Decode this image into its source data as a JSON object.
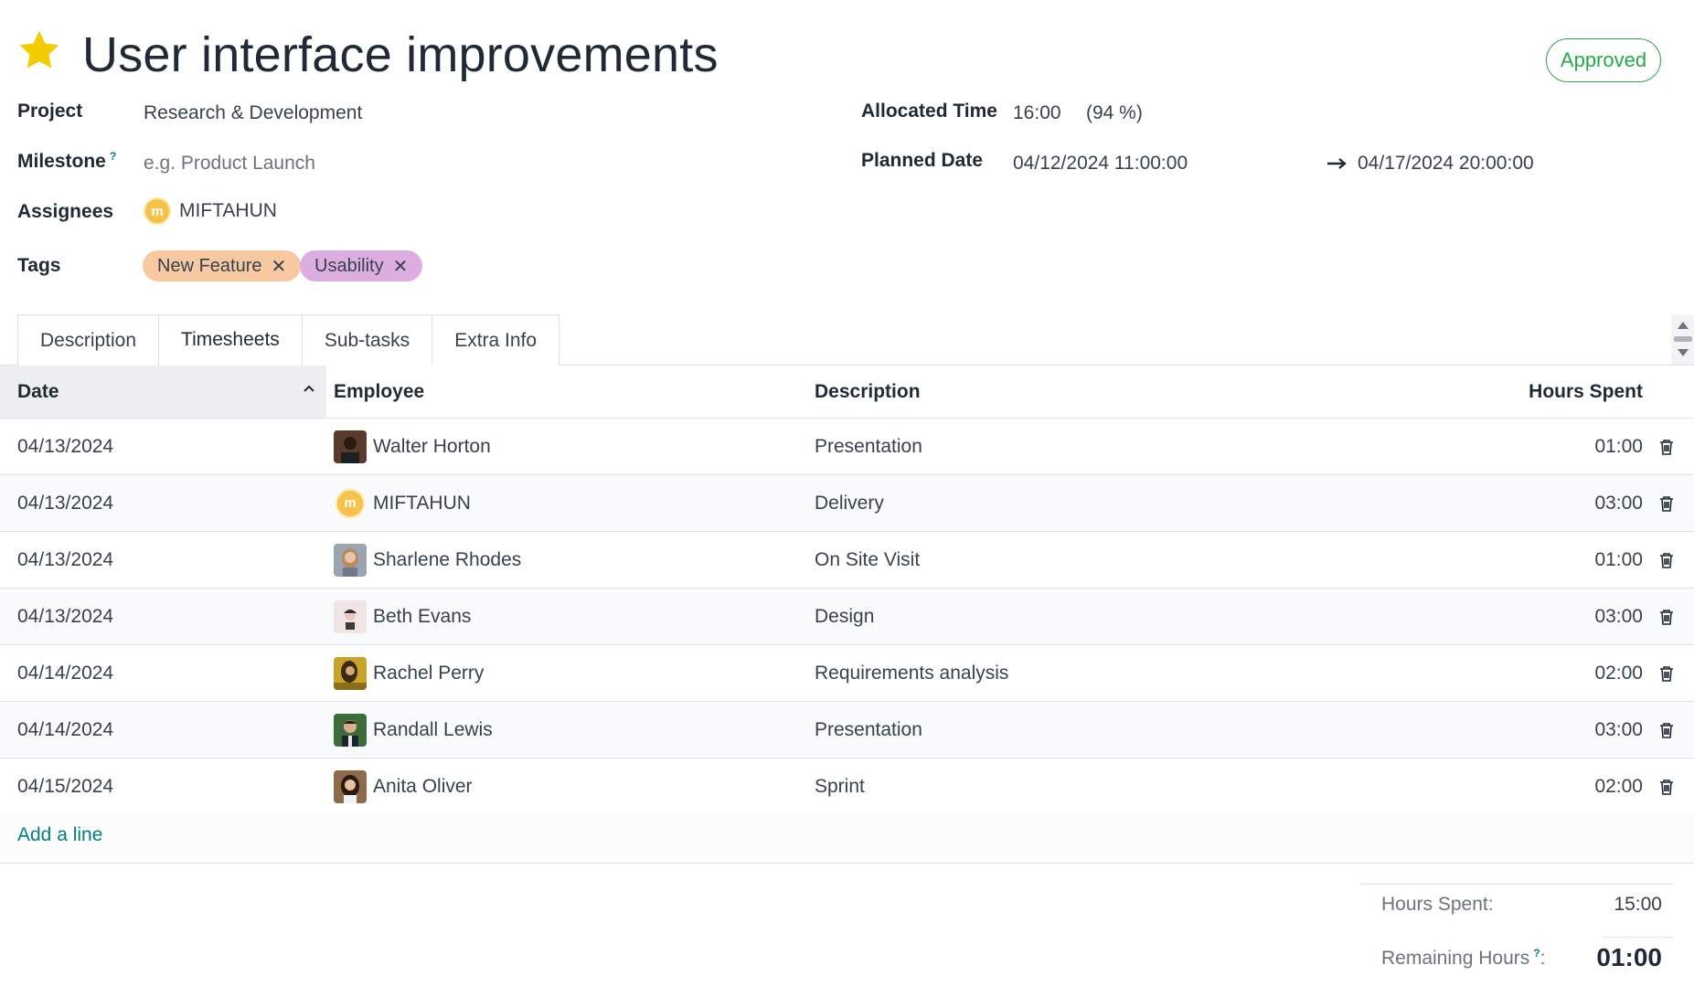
{
  "task": {
    "title": "User interface improvements",
    "status": "Approved",
    "starred": true
  },
  "fields": {
    "project_label": "Project",
    "project_value": "Research & Development",
    "milestone_label": "Milestone",
    "milestone_help": "?",
    "milestone_placeholder": "e.g. Product Launch",
    "assignees_label": "Assignees",
    "assignee_name": "MIFTAHUN",
    "tags_label": "Tags",
    "tags": [
      {
        "label": "New Feature",
        "color": "#f8c9a0"
      },
      {
        "label": "Usability",
        "color": "#dcaee0"
      }
    ],
    "allocated_label": "Allocated Time",
    "allocated_value": "16:00",
    "allocated_pct": "(94 %)",
    "planned_label": "Planned Date",
    "planned_start": "04/12/2024 11:00:00",
    "planned_end": "04/17/2024 20:00:00"
  },
  "tabs": [
    "Description",
    "Timesheets",
    "Sub-tasks",
    "Extra Info"
  ],
  "active_tab": "Timesheets",
  "table": {
    "headers": {
      "date": "Date",
      "employee": "Employee",
      "description": "Description",
      "hours": "Hours Spent"
    },
    "rows": [
      {
        "date": "04/13/2024",
        "employee": "Walter Horton",
        "description": "Presentation",
        "hours": "01:00"
      },
      {
        "date": "04/13/2024",
        "employee": "MIFTAHUN",
        "description": "Delivery",
        "hours": "03:00"
      },
      {
        "date": "04/13/2024",
        "employee": "Sharlene Rhodes",
        "description": "On Site Visit",
        "hours": "01:00"
      },
      {
        "date": "04/13/2024",
        "employee": "Beth Evans",
        "description": "Design",
        "hours": "03:00"
      },
      {
        "date": "04/14/2024",
        "employee": "Rachel Perry",
        "description": "Requirements analysis",
        "hours": "02:00"
      },
      {
        "date": "04/14/2024",
        "employee": "Randall Lewis",
        "description": "Presentation",
        "hours": "03:00"
      },
      {
        "date": "04/15/2024",
        "employee": "Anita Oliver",
        "description": "Sprint",
        "hours": "02:00"
      }
    ],
    "add_line": "Add a line"
  },
  "totals": {
    "hours_spent_label": "Hours Spent:",
    "hours_spent_value": "15:00",
    "remaining_label": "Remaining Hours",
    "remaining_help": "?",
    "remaining_colon": ":",
    "remaining_value": "01:00"
  },
  "colors": {
    "accent": "#017e84",
    "status_green": "#28a745",
    "star": "#f3cc00"
  }
}
